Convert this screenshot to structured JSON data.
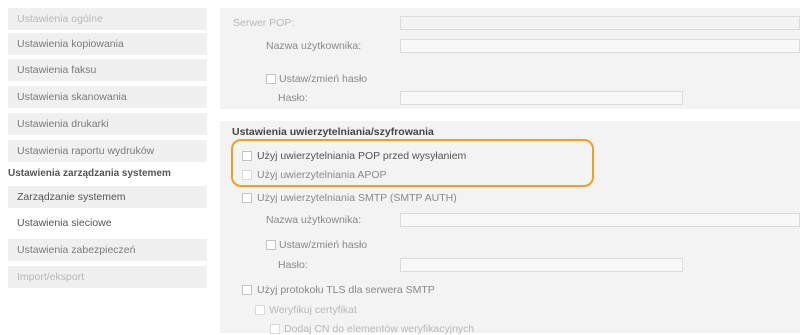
{
  "sidebar": {
    "items": [
      {
        "label": "Ustawienia ogólne"
      },
      {
        "label": "Ustawienia kopiowania"
      },
      {
        "label": "Ustawienia faksu"
      },
      {
        "label": "Ustawienia skanowania"
      },
      {
        "label": "Ustawienia drukarki"
      },
      {
        "label": "Ustawienia raportu wydruków"
      }
    ],
    "section_header": "Ustawienia zarządzania systemem",
    "sub_items": [
      {
        "label": "Zarządzanie systemem"
      },
      {
        "label": "Ustawienia sieciowe"
      },
      {
        "label": "Ustawienia zabezpieczeń"
      },
      {
        "label": "Import/eksport"
      }
    ]
  },
  "pop": {
    "server_label": "Serwer POP:",
    "username_label": "Nazwa użytkownika:",
    "set_password_label": "Ustaw/zmień hasło",
    "password_label": "Hasło:"
  },
  "auth": {
    "section_title": "Ustawienia uwierzytelniania/szyfrowania",
    "pop_before_send": "Użyj uwierzytelniania POP przed wysyłaniem",
    "apop": "Użyj uwierzytelniania APOP",
    "smtp_auth": "Użyj uwierzytelniania SMTP (SMTP AUTH)",
    "smtp_username_label": "Nazwa użytkownika:",
    "smtp_set_password_label": "Ustaw/zmień hasło",
    "smtp_password_label": "Hasło:",
    "tls_smtp": "Użyj protokołu TLS dla serwera SMTP",
    "verify_cert": "Weryfikuj certyfikat",
    "add_cn": "Dodaj CN do elementów weryfikacyjnych"
  },
  "colors": {
    "highlight": "#f0a020"
  }
}
